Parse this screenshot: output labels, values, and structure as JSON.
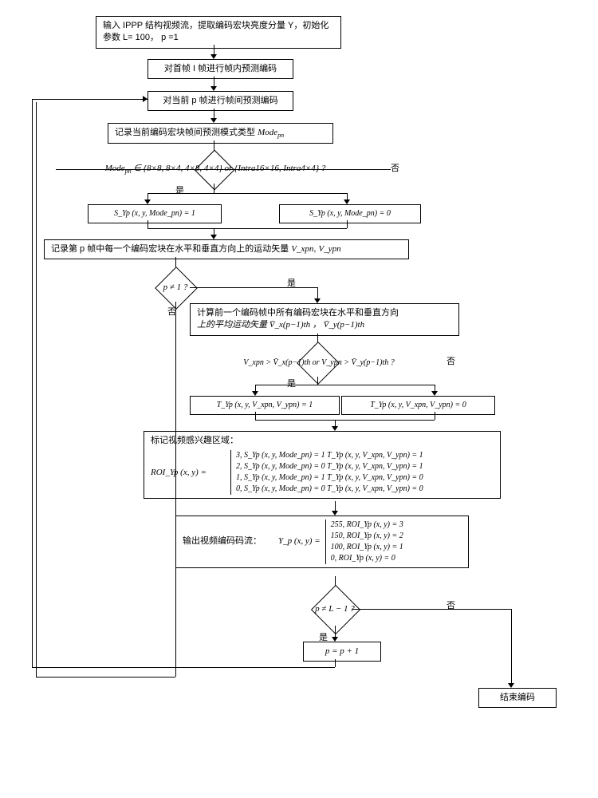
{
  "b1": "输入 IPPP 结构视频流，提取编码宏块亮度分量 Y，初始化参数 L= 100， p =1",
  "b2": "对首帧 I 帧进行帧内预测编码",
  "b3": "对当前 p 帧进行帧间预测编码",
  "b4_pre": "记录当前编码宏块帧间预测模式类型 ",
  "b4_var": "Mode",
  "b4_sub": "pn",
  "d1_var": "Mode",
  "d1_sub": "pn",
  "d1_rest": " ∈ {8×8, 8×4, 4×8, 4×4} or {Intra16×16, Intra4×4} ?",
  "b5a": "S_Yp (x, y, Mode_pn) = 1",
  "b5b": "S_Yp (x, y, Mode_pn) = 0",
  "b6_pre": "记录第 p 帧中每一个编码宏块在水平和垂直方向上的运动矢量 ",
  "b6_v1": "V_xpn",
  "b6_v2": "V_ypn",
  "d2": "p ≠ 1 ?",
  "b7_l1": "计算前一个编码帧中所有编码宏块在水平和垂直方向",
  "b7_l2": "上的平均运动矢量 V̄_x(p−1)th ， V̄_y(p−1)th",
  "d3": "V_xpn > V̄_x(p−1)th   or   V_ypn > V̄_y(p−1)th ?",
  "b8a": "T_Yp (x, y, V_xpn, V_ypn) = 1",
  "b8b": "T_Yp (x, y, V_xpn, V_ypn) = 0",
  "b9_title": "标记视频感兴趣区域：",
  "b9_lhs": "ROI_Yp (x, y) =",
  "b9_r0": "3, S_Yp (x, y, Mode_pn) = 1  T_Yp (x, y, V_xpn, V_ypn) = 1",
  "b9_r1": "2, S_Yp (x, y, Mode_pn) = 0  T_Yp (x, y, V_xpn, V_ypn) = 1",
  "b9_r2": "1, S_Yp (x, y, Mode_pn) = 1  T_Yp (x, y, V_xpn, V_ypn) = 0",
  "b9_r3": "0, S_Yp (x, y, Mode_pn) = 0  T_Yp (x, y, V_xpn, V_ypn) = 0",
  "b10_pre": "输出视频编码码流：",
  "b10_lhs": "Y_p (x, y) =",
  "b10_r0": "255, ROI_Yp (x, y) = 3",
  "b10_r1": "150, ROI_Yp (x, y) = 2",
  "b10_r2": "100, ROI_Yp (x, y) = 1",
  "b10_r3": "  0, ROI_Yp (x, y) = 0",
  "d4": "p ≠ L − 1 ?",
  "b11": "p = p + 1",
  "b12": "结束编码",
  "yes": "是",
  "no": "否"
}
